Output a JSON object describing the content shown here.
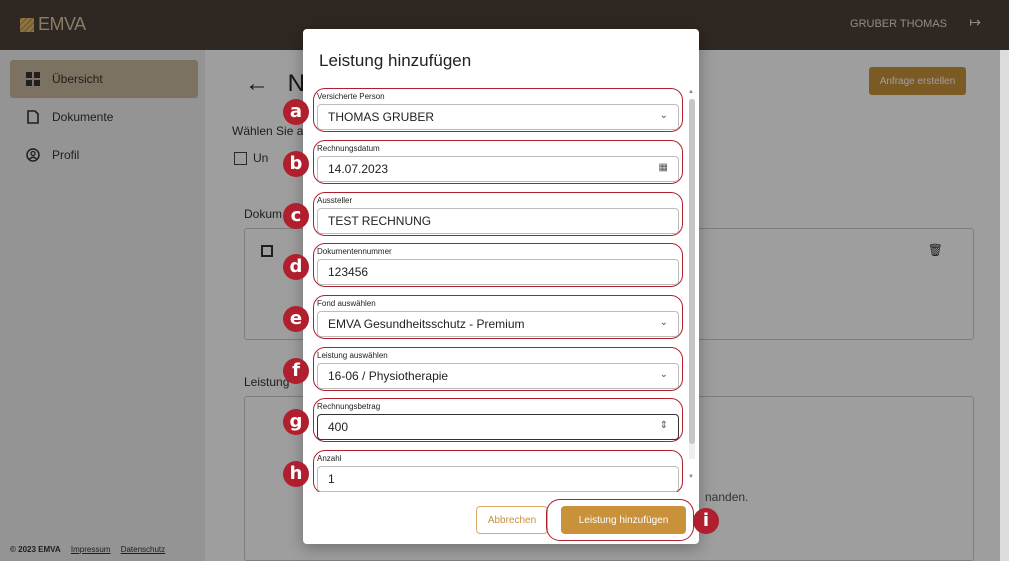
{
  "app": {
    "logo_text": "EMVA",
    "user_name": "GRUBER THOMAS"
  },
  "sidebar": {
    "items": [
      {
        "label": "Übersicht",
        "icon": "grid-icon"
      },
      {
        "label": "Dokumente",
        "icon": "document-icon"
      },
      {
        "label": "Profil",
        "icon": "user-circle-icon"
      }
    ],
    "footer": {
      "copyright": "© 2023 EMVA",
      "impressum": "Impressum",
      "datenschutz": "Datenschutz"
    }
  },
  "page": {
    "heading": "N",
    "wahlen": "Wählen Sie a",
    "checkbox_label": "Un",
    "dokumente_label": "Dokum",
    "leistung_label": "Leistung",
    "empty_text": "nanden.",
    "request_button": "Anfrage erstellen"
  },
  "modal": {
    "title": "Leistung hinzufügen",
    "fields": {
      "versicherte_person": {
        "label": "Versicherte Person",
        "value": "THOMAS GRUBER"
      },
      "rechnungsdatum": {
        "label": "Rechnungsdatum",
        "value": "14.07.2023"
      },
      "aussteller": {
        "label": "Aussteller",
        "value": "TEST RECHNUNG"
      },
      "dokumentennummer": {
        "label": "Dokumentennummer",
        "value": "123456"
      },
      "fond": {
        "label": "Fond auswählen",
        "value": "EMVA Gesundheitsschutz - Premium"
      },
      "leistung": {
        "label": "Leistung auswählen",
        "value": "16-06 / Physiotherapie"
      },
      "rechnungsbetrag": {
        "label": "Rechnungsbetrag",
        "value": "400"
      },
      "anzahl": {
        "label": "Anzahl",
        "value": "1"
      }
    },
    "cancel_button": "Abbrechen",
    "submit_button": "Leistung hinzufügen"
  },
  "markers": [
    "a",
    "b",
    "c",
    "d",
    "e",
    "f",
    "g",
    "h",
    "i"
  ],
  "colors": {
    "topbar": "#4d3f36",
    "accent": "#c8913a",
    "marker": "#b01f2e",
    "sidebar_active": "#c9b99e"
  }
}
